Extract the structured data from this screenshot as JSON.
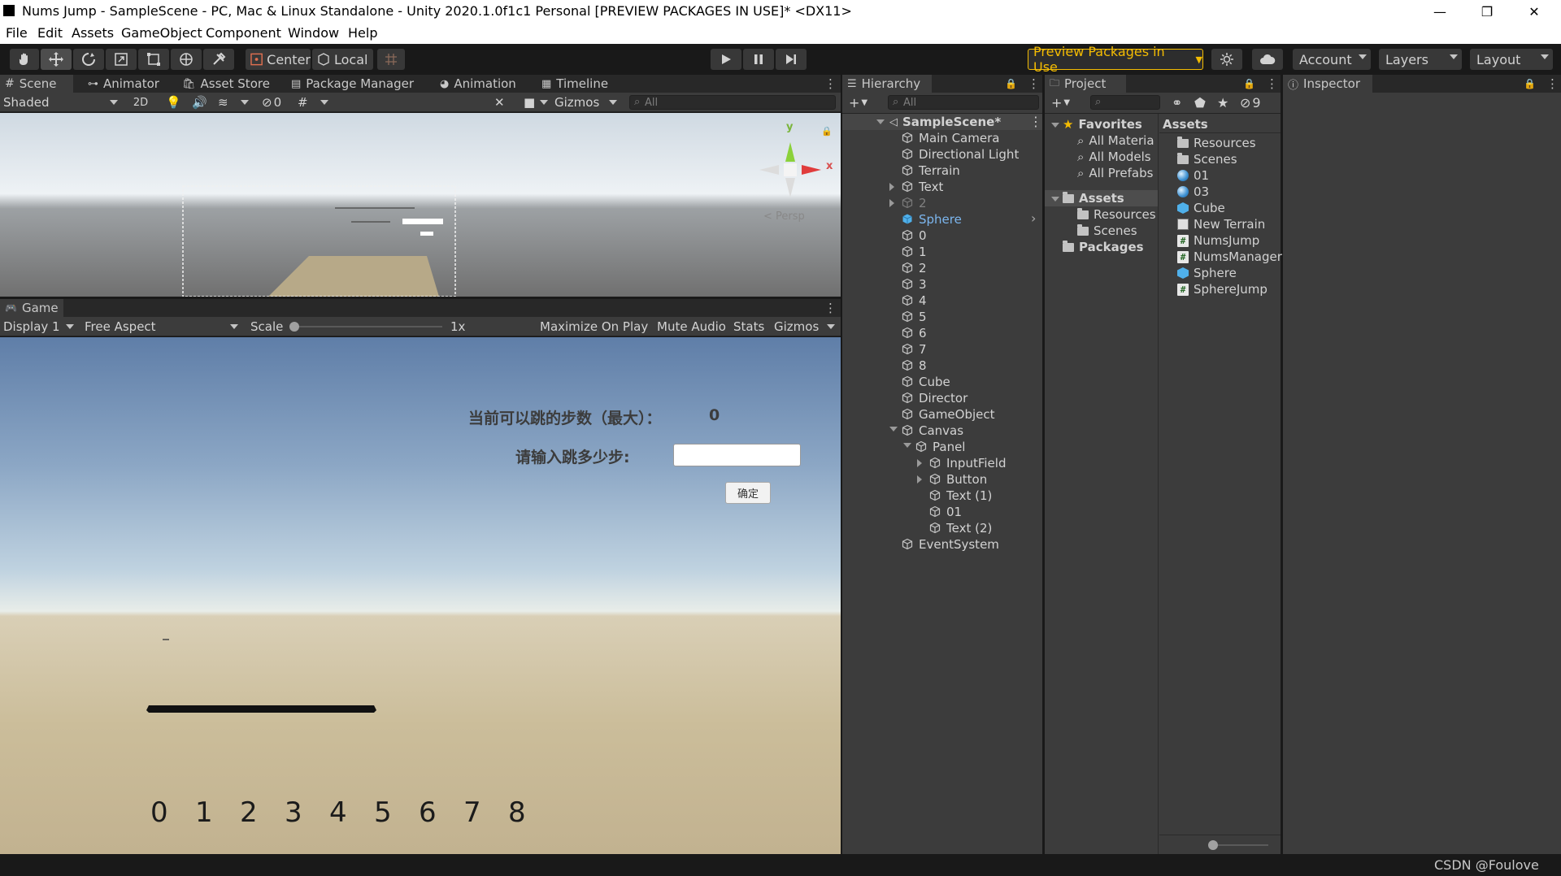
{
  "window": {
    "title": "Nums Jump - SampleScene - PC, Mac & Linux Standalone - Unity 2020.1.0f1c1 Personal [PREVIEW PACKAGES IN USE]* <DX11>",
    "minimize": "—",
    "maximize": "❐",
    "close": "✕"
  },
  "menu": [
    "File",
    "Edit",
    "Assets",
    "GameObject",
    "Component",
    "Window",
    "Help"
  ],
  "toolbar": {
    "center_label": "Center",
    "local_label": "Local",
    "preview_packages_label": "Preview Packages in Use",
    "account_label": "Account",
    "layers_label": "Layers",
    "layout_label": "Layout",
    "accent_color": "#f4bc02"
  },
  "scene_tabs": [
    "Scene",
    "Animator",
    "Asset Store",
    "Package Manager",
    "Animation",
    "Timeline"
  ],
  "scene_bar": {
    "shading": "Shaded",
    "mode_2d": "2D",
    "hidden_count": "0",
    "gizmos_label": "Gizmos",
    "search_placeholder": "All",
    "persp_label": "< Persp",
    "axis_x": "x",
    "axis_y": "y"
  },
  "game": {
    "tab_label": "Game",
    "display": "Display 1",
    "aspect": "Free Aspect",
    "scale_label": "Scale",
    "scale_value": "1x",
    "maximize_label": "Maximize On Play",
    "mute_label": "Mute Audio",
    "stats_label": "Stats",
    "gizmos_label": "Gizmos",
    "max_steps_label": "当前可以跳的步数（最大）：",
    "max_steps_value": "0",
    "input_prompt": "请输入跳多少步:",
    "input_value": "",
    "confirm_button": "确定",
    "numbers": [
      "0",
      "1",
      "2",
      "3",
      "4",
      "5",
      "6",
      "7",
      "8"
    ]
  },
  "hierarchy": {
    "tab_label": "Hierarchy",
    "search_placeholder": "All",
    "scene_name": "SampleScene*",
    "items": [
      "Main Camera",
      "Directional Light",
      "Terrain",
      "Text",
      "2",
      "Sphere",
      "0",
      "1",
      "2",
      "3",
      "4",
      "5",
      "6",
      "7",
      "8",
      "Cube",
      "Director",
      "GameObject",
      "Canvas",
      "Panel",
      "InputField",
      "Button",
      "Text (1)",
      "01",
      "Text (2)",
      "EventSystem"
    ]
  },
  "project": {
    "tab_label": "Project",
    "hidden_count": "9",
    "favorites_label": "Favorites",
    "favorites": [
      "All Materia",
      "All Models",
      "All Prefabs"
    ],
    "assets_label": "Assets",
    "asset_folders": [
      "Resources",
      "Scenes"
    ],
    "packages_label": "Packages",
    "right_header": "Assets",
    "asset_items": [
      "Resources",
      "Scenes",
      "01",
      "03",
      "Cube",
      "New Terrain",
      "NumsJump",
      "NumsManager",
      "Sphere",
      "SphereJump"
    ]
  },
  "inspector": {
    "tab_label": "Inspector"
  },
  "status": {
    "watermark": "CSDN @Foulove"
  }
}
